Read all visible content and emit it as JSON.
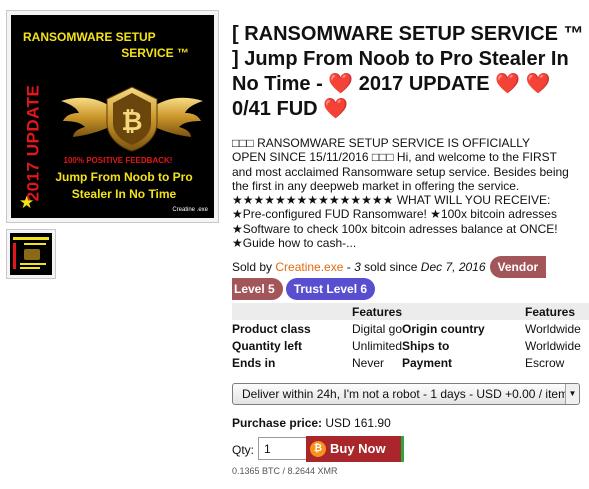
{
  "product_image": {
    "title_line1": "RANSOMWARE SETUP",
    "title_line2": "SERVICE ™",
    "side_text": "2017 UPDATE",
    "feedback": "100% POSITIVE FEEDBACK!",
    "slogan_line1": "Jump From Noob to Pro",
    "slogan_line2": "Stealer In No Time",
    "credit": "Creatine .exe"
  },
  "listing": {
    "title_text": "[ RANSOMWARE SETUP SERVICE ™ ] Jump From Noob to Pro Stealer In No Time - ",
    "title_update": " 2017 UPDATE ",
    "title_end": "0/41 FUD ",
    "heart_glyph": "❤️",
    "description_lines": [
      "□□□ RANSOMWARE SETUP SERVICE IS OFFICIALLY",
      "OPEN SINCE 15/11/2016 □□□ Hi, and welcome to the FIRST",
      "and most acclaimed Ransomware setup service. Besides being",
      "the first in any deepweb market in offering the service.",
      "★★★★★★★★★★★★★★★ WHAT WILL YOU RECEIVE:",
      "★Pre-configured FUD Ransomware! ★100x bitcoin adresses",
      "★Software to check 100x bitcoin adresses balance at ONCE!",
      "★Guide how to cash-..."
    ]
  },
  "seller": {
    "sold_by_prefix": "Sold by ",
    "vendor": "Creatine.exe",
    "dash": " - ",
    "sold_count": "3",
    "sold_since": " sold since ",
    "since_date": "Dec 7, 2016",
    "vendor_badge": "Vendor",
    "level_badge": "Level 5",
    "trust_badge": "Trust Level 6"
  },
  "features_table": {
    "header_left": "Features",
    "header_right": "Features",
    "rows": [
      {
        "label1": "Product class",
        "value1": "Digital goods",
        "label2": "Origin country",
        "value2": "Worldwide"
      },
      {
        "label1": "Quantity left",
        "value1": "Unlimited",
        "label2": "Ships to",
        "value2": "Worldwide"
      },
      {
        "label1": "Ends in",
        "value1": "Never",
        "label2": "Payment",
        "value2": "Escrow"
      }
    ]
  },
  "delivery": {
    "selected": "Deliver within 24h, I'm not a robot - 1 days - USD +0.00 / item"
  },
  "purchase": {
    "price_label": "Purchase price:",
    "price_value": " USD 161.90",
    "qty_label": "Qty:",
    "qty_value": "1",
    "buy_label": "Buy Now",
    "btc_symbol": "₿",
    "alt_price": "0.1365 BTC / 8.2644 XMR"
  },
  "colors": {
    "vendor_link": "#e06a0e",
    "badge_vendor": "#a2565a",
    "badge_trust": "#5a4ed0",
    "buy_button": "#a9262a",
    "art_yellow": "#f3e21a",
    "art_red": "#e3161a"
  }
}
